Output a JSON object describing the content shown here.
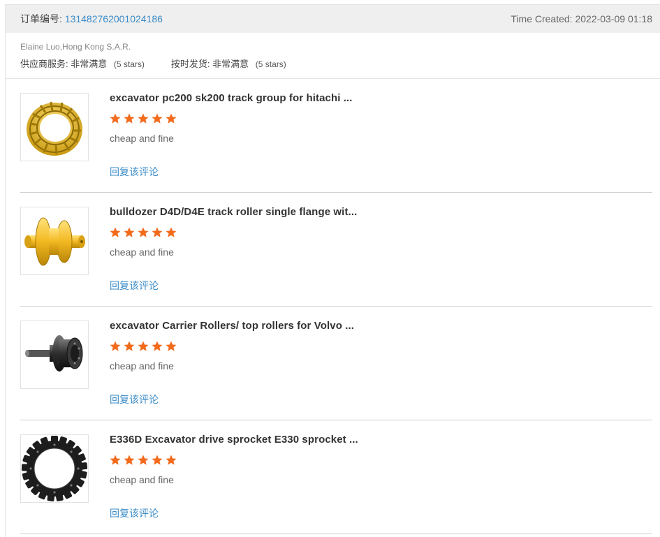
{
  "order": {
    "label": "订单编号:",
    "id": "131482762001024186",
    "time_created": "Time Created: 2022-03-09 01:18"
  },
  "buyer": {
    "name": "Elaine Luo,Hong Kong S.A.R.",
    "supplier_service": {
      "label": "供应商服务:",
      "value": "非常满意",
      "stars": "(5 stars)"
    },
    "on_time_shipping": {
      "label": "按时发货:",
      "value": "非常满意",
      "stars": "(5 stars)"
    }
  },
  "colors": {
    "star": "#f26b1d",
    "link": "#3a8bc8"
  },
  "items": [
    {
      "title": "excavator pc200 sk200 track group for hitachi ...",
      "rating": 5,
      "comment": "cheap and fine",
      "reply": "回复该评论",
      "image_icon": "track-chain-icon"
    },
    {
      "title": "bulldozer D4D/D4E track roller single flange wit...",
      "rating": 5,
      "comment": "cheap and fine",
      "reply": "回复该评论",
      "image_icon": "track-roller-icon"
    },
    {
      "title": "excavator Carrier Rollers/ top rollers for Volvo ...",
      "rating": 5,
      "comment": "cheap and fine",
      "reply": "回复该评论",
      "image_icon": "carrier-roller-icon"
    },
    {
      "title": "E336D Excavator drive sprocket E330 sprocket ...",
      "rating": 5,
      "comment": "cheap and fine",
      "reply": "回复该评论",
      "image_icon": "sprocket-icon"
    }
  ]
}
